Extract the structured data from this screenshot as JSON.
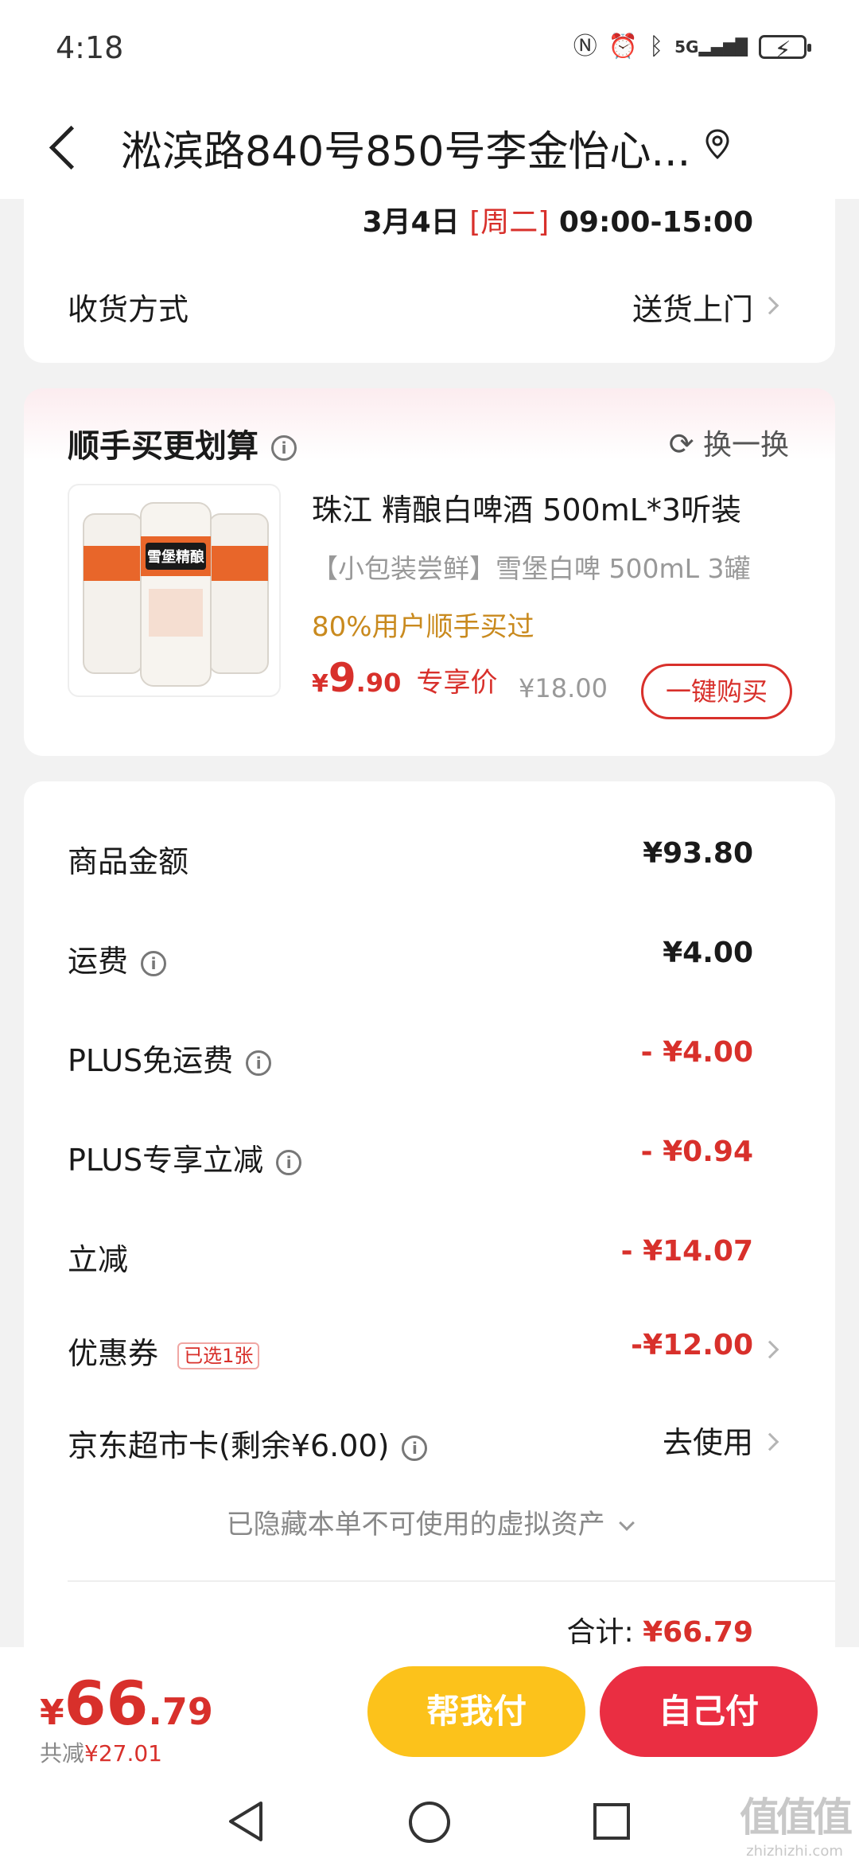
{
  "status_bar": {
    "time": "4:18",
    "network": "5G",
    "battery": "⚡"
  },
  "header": {
    "title": "淞滨路840号850号李金怡心..."
  },
  "delivery": {
    "date": "3月4日",
    "weekday": "[周二]",
    "time_range": "09:00-15:00",
    "method_label": "收货方式",
    "method_value": "送货上门"
  },
  "upsell": {
    "title": "顺手买更划算",
    "refresh_label": "换一换",
    "product": {
      "can_brand_text": "雪堡精酿",
      "name": "珠江 精酿白啤酒 500mL*3听装",
      "subtitle": "【小包装尝鲜】雪堡白啤 500mL 3罐",
      "social_proof": "80%用户顺手买过",
      "currency": "¥",
      "price_int": "9",
      "price_dec": ".90",
      "price_tag": "专享价",
      "original_price": "¥18.00",
      "buy_button": "一键购买"
    }
  },
  "summary": {
    "rows": [
      {
        "label": "商品金额",
        "value": "¥93.80"
      },
      {
        "label": "运费",
        "value": "¥4.00"
      },
      {
        "label": "PLUS免运费",
        "value": "- ¥4.00"
      },
      {
        "label": "PLUS专享立减",
        "value": "- ¥0.94"
      },
      {
        "label": "立减",
        "value": "- ¥14.07"
      }
    ],
    "coupon_label": "优惠券",
    "coupon_badge": "已选1张",
    "coupon_value": "-¥12.00",
    "card_label": "京东超市卡(剩余¥6.00)",
    "card_value": "去使用",
    "hidden_note": "已隐藏本单不可使用的虚拟资产",
    "total_label": "合计:",
    "total_value": "¥66.79"
  },
  "bottom": {
    "currency": "¥",
    "price_int": "66",
    "price_dec": ".79",
    "saved_label": "共减",
    "saved_value": "¥27.01",
    "help_pay": "帮我付",
    "self_pay": "自己付"
  },
  "watermark": {
    "text": "值值值",
    "site": "zhizhizhi.com"
  },
  "colors": {
    "accent_red": "#d8302b",
    "pay_yellow": "#fcc21b",
    "pay_red": "#ea2e42",
    "social_orange": "#c98a1e"
  }
}
